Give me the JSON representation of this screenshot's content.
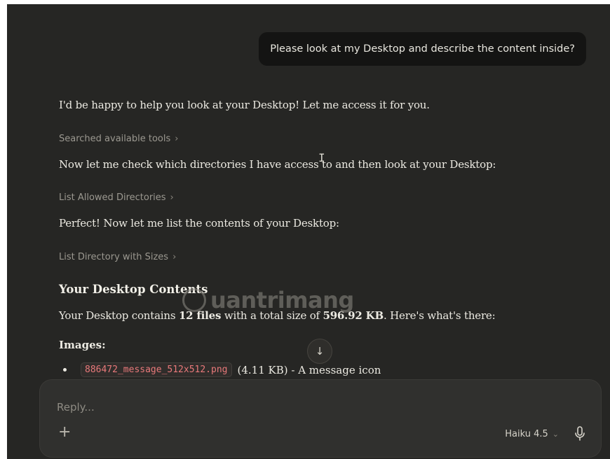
{
  "user_message": "Please look at my Desktop and describe the content inside?",
  "assistant": {
    "intro": "I'd be happy to help you look at your Desktop! Let me access it for you.",
    "tool1": "Searched available tools",
    "line2": "Now let me check which directories I have access to and then look at your Desktop:",
    "tool2": "List Allowed Directories",
    "line3": "Perfect! Now let me list the contents of your Desktop:",
    "tool3": "List Directory with Sizes",
    "heading": "Your Desktop Contents",
    "summary": {
      "pre": "Your Desktop contains ",
      "files": "12 files",
      "mid": " with a total size of ",
      "size": "596.92 KB",
      "post": ". Here's what's there:"
    },
    "images_label": "Images:",
    "items": [
      {
        "filename": "886472_message_512x512.png",
        "desc": "(4.11 KB) - A message icon"
      }
    ]
  },
  "tool_chevron": "›",
  "scroll_icon": "↓",
  "composer": {
    "placeholder": "Reply...",
    "plus_icon": "+",
    "model": "Haiku 4.5",
    "model_chevron": "⌄"
  },
  "watermark": "uantrimang",
  "colors": {
    "background": "#262624",
    "code_text": "#e8797a",
    "composer_bg": "#30302e"
  }
}
